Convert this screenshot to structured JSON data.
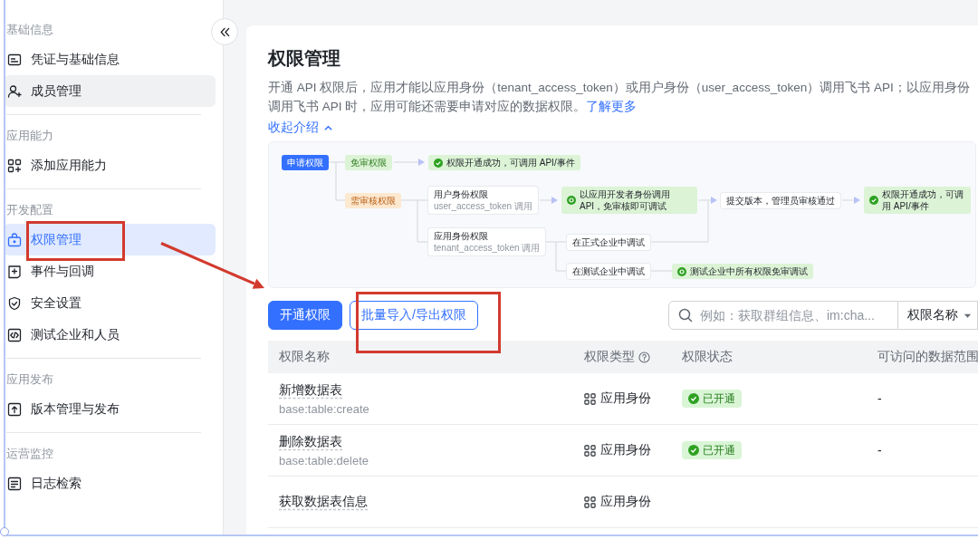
{
  "sidebar": {
    "groups": [
      {
        "heading": "基础信息",
        "items": [
          {
            "label": "凭证与基础信息",
            "selected": false,
            "hovered": false
          },
          {
            "label": "成员管理",
            "selected": false,
            "hovered": true
          }
        ]
      },
      {
        "heading": "应用能力",
        "items": [
          {
            "label": "添加应用能力",
            "selected": false,
            "hovered": false
          }
        ]
      },
      {
        "heading": "开发配置",
        "items": [
          {
            "label": "权限管理",
            "selected": true,
            "hovered": false
          },
          {
            "label": "事件与回调",
            "selected": false,
            "hovered": false
          },
          {
            "label": "安全设置",
            "selected": false,
            "hovered": false
          },
          {
            "label": "测试企业和人员",
            "selected": false,
            "hovered": false
          }
        ]
      },
      {
        "heading": "应用发布",
        "items": [
          {
            "label": "版本管理与发布",
            "selected": false,
            "hovered": false
          }
        ]
      },
      {
        "heading": "运营监控",
        "items": [
          {
            "label": "日志检索",
            "selected": false,
            "hovered": false
          }
        ]
      }
    ]
  },
  "main": {
    "title": "权限管理",
    "description": "开通 API 权限后，应用才能以应用身份（tenant_access_token）或用户身份（user_access_token）调用飞书 API；以应用身份调用飞书 API 时，应用可能还需要申请对应的数据权限。",
    "learn_more": "了解更多",
    "collapse_link": "收起介绍",
    "flow": {
      "nodes": [
        {
          "kind": "start",
          "text": "申请权限"
        },
        {
          "kind": "free",
          "text": "免审权限"
        },
        {
          "kind": "success",
          "text": "权限开通成功，可调用 API/事件"
        },
        {
          "kind": "review",
          "text": "需审核权限"
        },
        {
          "kind": "plain",
          "text": "用户身份权限",
          "note": "user_access_token 调用"
        },
        {
          "kind": "tip",
          "text": "以应用开发者身份调用 API，免审核即可调试"
        },
        {
          "kind": "plain",
          "text": "提交版本，管理员审核通过"
        },
        {
          "kind": "success",
          "text": "权限开通成功，可调用 API/事件"
        },
        {
          "kind": "plain",
          "text": "应用身份权限",
          "note": "tenant_access_token 调用"
        },
        {
          "kind": "plain",
          "text": "在正式企业中调试"
        },
        {
          "kind": "plain",
          "text": "在测试企业中调试"
        },
        {
          "kind": "tip",
          "text": "测试企业中所有权限免审调试"
        }
      ]
    },
    "actions": [
      {
        "label": "开通权限",
        "kind": "primary"
      },
      {
        "label": "批量导入/导出权限",
        "kind": "outline"
      }
    ],
    "search": {
      "placeholder": "例如：获取群组信息、im:cha...",
      "filter": "权限名称"
    },
    "table": {
      "columns": [
        {
          "label": "权限名称",
          "help": false
        },
        {
          "label": "权限类型",
          "help": true
        },
        {
          "label": "权限状态",
          "help": false
        },
        {
          "label": "可访问的数据范围",
          "help": false
        }
      ],
      "rows": [
        {
          "name": "新增数据表",
          "code": "base:table:create",
          "type": "应用身份",
          "status": "已开通",
          "scope": "-"
        },
        {
          "name": "删除数据表",
          "code": "base:table:delete",
          "type": "应用身份",
          "status": "已开通",
          "scope": "-"
        },
        {
          "name": "获取数据表信息",
          "type": "应用身份"
        }
      ]
    }
  }
}
